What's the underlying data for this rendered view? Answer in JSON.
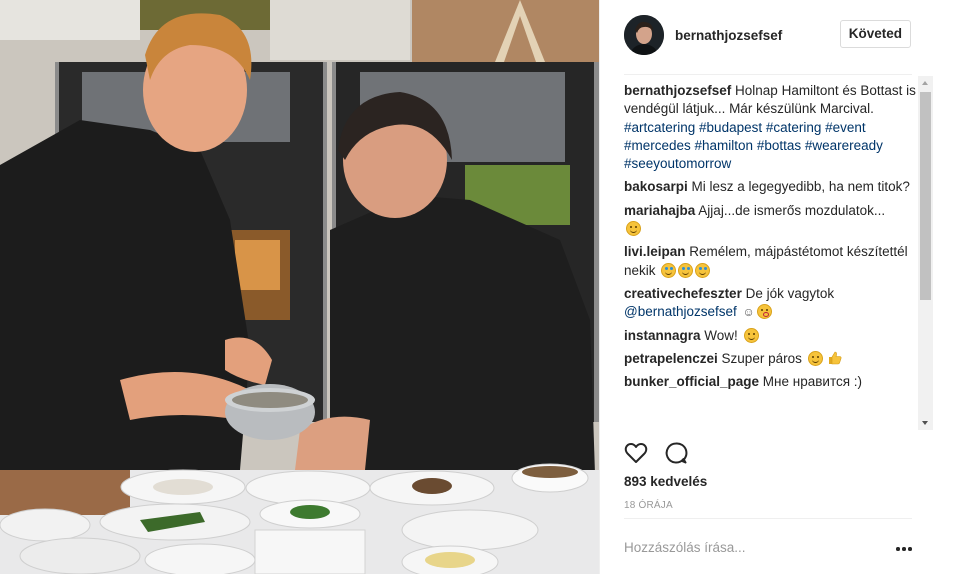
{
  "post": {
    "username": "bernathjozsefsef",
    "follow_label": "Követed",
    "caption": {
      "username": "bernathjozsefsef",
      "text": " Holnap Hamiltont és Bottast is vendégül látjuk... Már készülünk Marcival.",
      "hashtags": "#artcatering #budapest #catering #event #mercedes #hamilton #bottas #weareready #seeyoutomorrow"
    },
    "comments": [
      {
        "username": "bakosarpi",
        "text": " Mi lesz a legegyedibb, ha nem titok?"
      },
      {
        "username": "mariahajba",
        "text": " Ajjaj...de ismerős mozdulatok..."
      },
      {
        "username": "livi.leipan",
        "text": " Remélem, májpástétomot készítettél nekik"
      },
      {
        "username": "creativechefeszter",
        "text": " De jók vagytok",
        "mention": "@bernathjozsefsef"
      },
      {
        "username": "instannagra",
        "text": " Wow!"
      },
      {
        "username": "petrapelenczei",
        "text": " Szuper páros"
      },
      {
        "username": "bunker_official_page",
        "text": " Мне нравится :)"
      }
    ],
    "likes_text": "893 kedvelés",
    "time_text": "18 ÓRÁJA",
    "comment_placeholder": "Hozzászólás írása...",
    "icons": {
      "like": "heart-icon",
      "comment": "comment-bubble-icon",
      "more": "more-options-icon"
    }
  }
}
